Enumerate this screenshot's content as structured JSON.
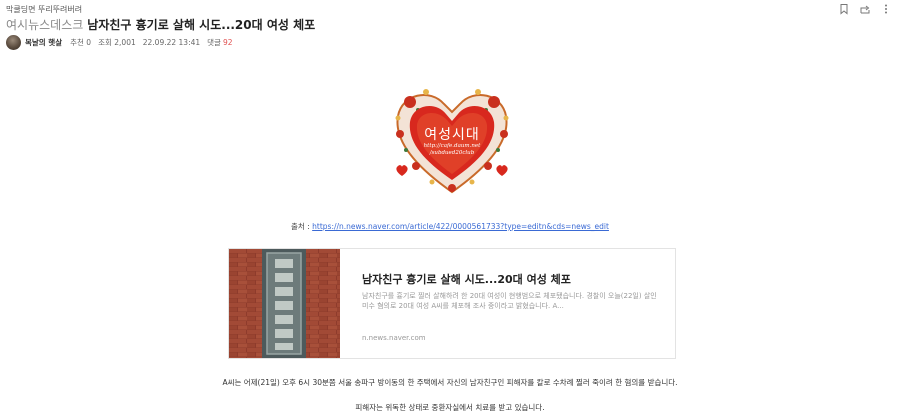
{
  "header": {
    "breadcrumb": "막쿨딩면 뚜리뚜려버려",
    "board": "여시뉴스데스크",
    "title": "남자친구 흉기로 살해 시도...20대 여성 체포"
  },
  "meta": {
    "author": "복날의 햇살",
    "recommend": "추천 0",
    "views": "조회 2,001",
    "date": "22.09.22 13:41",
    "comments_label": "댓글",
    "comments_count": "92"
  },
  "icons": {
    "bookmark": "bookmark-icon",
    "share": "share-icon",
    "more": "more-vertical-icon"
  },
  "logo": {
    "text": "여성시대",
    "url_line1": "http://cafe.daum.net",
    "url_line2": "/subdued20club"
  },
  "source": {
    "label": "출처 :",
    "url": "https://n.news.naver.com/article/422/0000561733?type=editn&cds=news_edit"
  },
  "link_card": {
    "title": "남자친구 흉기로 살해 시도...20대 여성 체포",
    "description": "남자친구를 흉기로 찔러 살해하려 한 20대 여성이 현행범으로 체포됐습니다. 경찰이 오늘(22일) 살인 미수 혐의로 20대 여성 A씨를 체포해 조사 중이라고 밝혔습니다. A...",
    "domain": "n.news.naver.com"
  },
  "body": {
    "p1": "A씨는 어제(21일) 오후 6시 30분쯤 서울 송파구 방이동의 한 주택에서 자신의 남자친구인 피해자를 칼로 수차례 찔러 죽이려 한 혐의를 받습니다.",
    "p2": "피해자는 위독한 상태로 중환자실에서 치료를 받고 있습니다."
  },
  "colors": {
    "link": "#3a6ad4",
    "comment_count": "#e05050",
    "heart_red": "#d8281e"
  }
}
